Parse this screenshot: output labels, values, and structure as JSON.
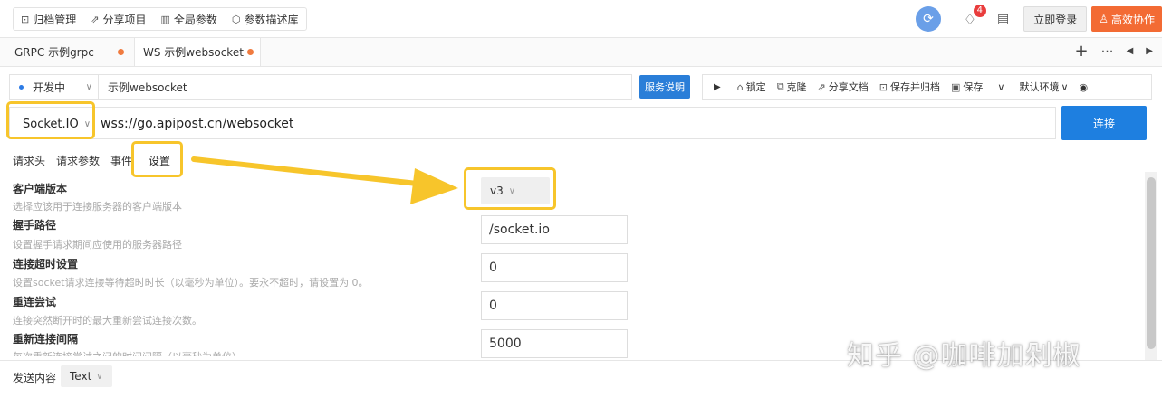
{
  "topbar": {
    "nav": [
      {
        "icon": "archive-icon",
        "label": "归档管理"
      },
      {
        "icon": "share-icon",
        "label": "分享项目"
      },
      {
        "icon": "params-icon",
        "label": "全局参数"
      },
      {
        "icon": "cube-icon",
        "label": "参数描述库"
      }
    ],
    "notification_count": "4",
    "login_label": "立即登录",
    "collab_label": "高效协作"
  },
  "tabs": [
    {
      "label": "GRPC 示例grpc",
      "active": false
    },
    {
      "label": "WS 示例websocket",
      "active": true
    }
  ],
  "request": {
    "env_label": "开发中",
    "name_value": "示例websocket",
    "service_btn": "服务说明",
    "toolbar": {
      "lock": "锁定",
      "clone": "克隆",
      "share_doc": "分享文档",
      "save_archive": "保存并归档",
      "save": "保存",
      "env_select": "默认环境"
    }
  },
  "url": {
    "protocol": "Socket.IO",
    "value": "wss://go.apipost.cn/websocket",
    "connect_label": "连接"
  },
  "subtabs": [
    "请求头",
    "请求参数",
    "事件",
    "设置"
  ],
  "settings": [
    {
      "title": "客户端版本",
      "desc": "选择应该用于连接服务器的客户端版本",
      "value": "v3"
    },
    {
      "title": "握手路径",
      "desc": "设置握手请求期间应使用的服务器路径",
      "value": "/socket.io"
    },
    {
      "title": "连接超时设置",
      "desc": "设置socket请求连接等待超时时长（以毫秒为单位）。要永不超时，请设置为 0。",
      "value": "0"
    },
    {
      "title": "重连尝试",
      "desc": "连接突然断开时的最大重新尝试连接次数。",
      "value": "0"
    },
    {
      "title": "重新连接间隔",
      "desc": "每次重新连接尝试之间的时间间隔（以毫秒为单位）",
      "value": "5000"
    }
  ],
  "bottom": {
    "send_label": "发送内容",
    "format": "Text"
  },
  "watermark": "知乎 @咖啡加剁椒",
  "colors": {
    "accent_blue": "#1e7fe0",
    "highlight_yellow": "#f7c52b",
    "collab_orange": "#f36b34",
    "tab_dot": "#f07b3f"
  }
}
